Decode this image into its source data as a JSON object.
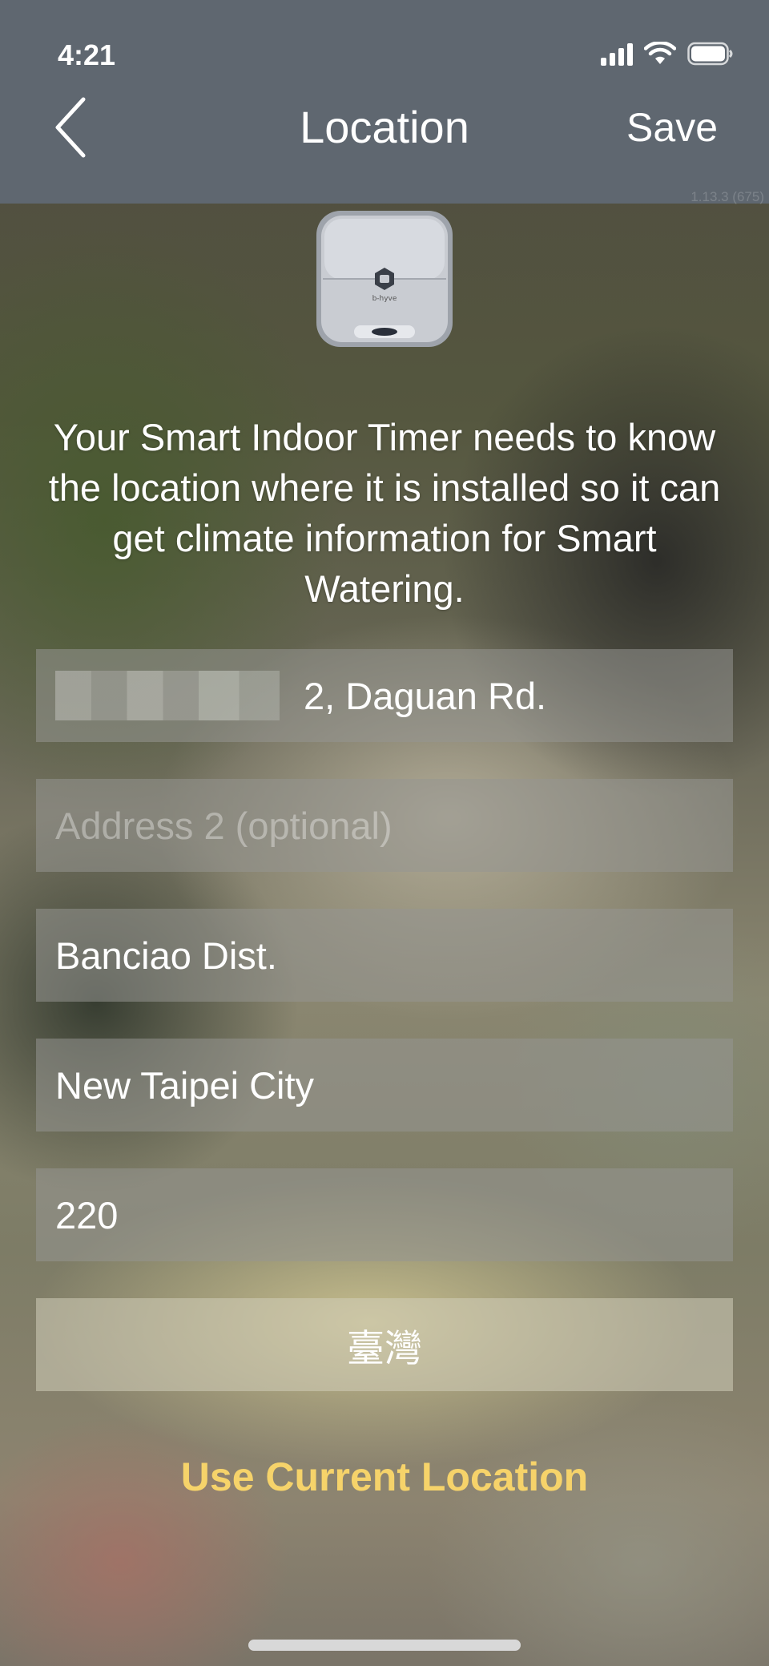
{
  "status_bar": {
    "time": "4:21"
  },
  "nav": {
    "title": "Location",
    "save_label": "Save",
    "version": "1.13.3 (675)"
  },
  "device": {
    "brand_label": "b-hyve"
  },
  "description": "Your Smart Indoor Timer needs to know the location where it is installed so it can get climate information for Smart Watering.",
  "form": {
    "address1_value": "2, Daguan Rd.",
    "address2_placeholder": "Address 2 (optional)",
    "city_value": "Banciao Dist.",
    "state_value": "New Taipei City",
    "zip_value": "220",
    "country_value": "臺灣"
  },
  "use_current_location_label": "Use Current Location",
  "colors": {
    "nav_background": "#5f6770",
    "accent_link": "#f6d36a"
  }
}
